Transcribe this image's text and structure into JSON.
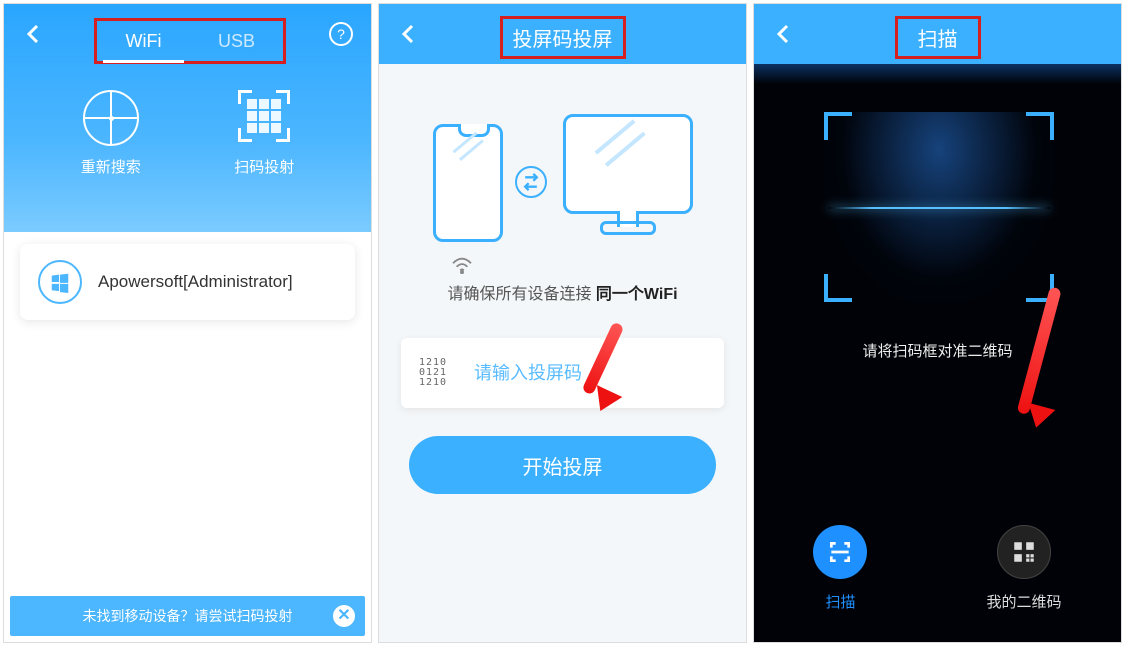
{
  "screen1": {
    "tabs": {
      "wifi": "WiFi",
      "usb": "USB"
    },
    "actions": {
      "rescan": "重新搜索",
      "scan_cast": "扫码投射"
    },
    "device": {
      "name": "Apowersoft[Administrator]"
    },
    "banner": {
      "text": "未找到移动设备？请尝试扫码投射"
    }
  },
  "screen2": {
    "title": "投屏码投屏",
    "instruction_prefix": "请确保所有设备连接 ",
    "instruction_strong": "同一个WiFi",
    "code_icon_text": "1210\n0121\n1210",
    "input_placeholder": "请输入投屏码",
    "button": "开始投屏"
  },
  "screen3": {
    "title": "扫描",
    "hint": "请将扫码框对准二维码",
    "bottom": {
      "scan": "扫描",
      "my_qr": "我的二维码"
    }
  }
}
